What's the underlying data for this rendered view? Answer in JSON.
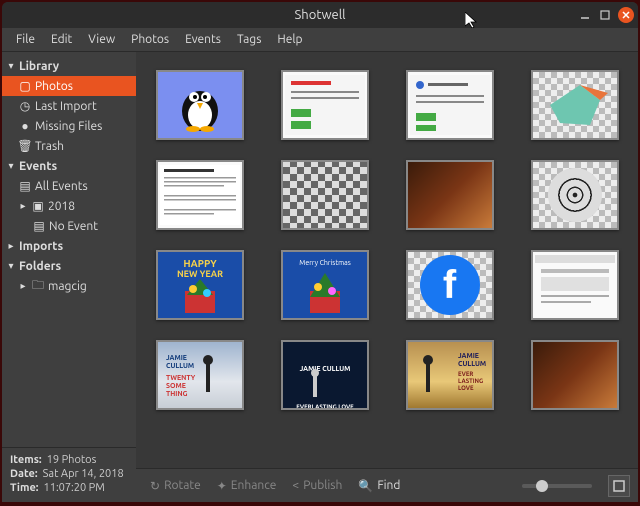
{
  "window": {
    "title": "Shotwell"
  },
  "menu": [
    "File",
    "Edit",
    "View",
    "Photos",
    "Events",
    "Tags",
    "Help"
  ],
  "tree": {
    "library": {
      "label": "Library",
      "photos": "Photos",
      "last_import": "Last Import",
      "missing": "Missing Files",
      "trash": "Trash"
    },
    "events": {
      "label": "Events",
      "all_events": "All Events",
      "y2018": "2018",
      "no_event": "No Event"
    },
    "imports": {
      "label": "Imports"
    },
    "folders": {
      "label": "Folders",
      "magcig": "magcig"
    }
  },
  "status": {
    "items_label": "Items:",
    "items_value": "19 Photos",
    "date_label": "Date:",
    "date_value": "Sat Apr 14, 2018",
    "time_label": "Time:",
    "time_value": "11:07:20 PM"
  },
  "toolbar": {
    "rotate": "Rotate",
    "enhance": "Enhance",
    "publish": "Publish",
    "find": "Find"
  },
  "thumbs": [
    {
      "id": "penguin"
    },
    {
      "id": "screenshot1"
    },
    {
      "id": "screenshot2"
    },
    {
      "id": "snap-checker"
    },
    {
      "id": "document"
    },
    {
      "id": "escher"
    },
    {
      "id": "painting1"
    },
    {
      "id": "target-checker"
    },
    {
      "id": "newyear"
    },
    {
      "id": "xmas"
    },
    {
      "id": "fb-checker"
    },
    {
      "id": "screenshot3"
    },
    {
      "id": "album-blue"
    },
    {
      "id": "album-dark"
    },
    {
      "id": "album-gold"
    },
    {
      "id": "painting2"
    }
  ]
}
